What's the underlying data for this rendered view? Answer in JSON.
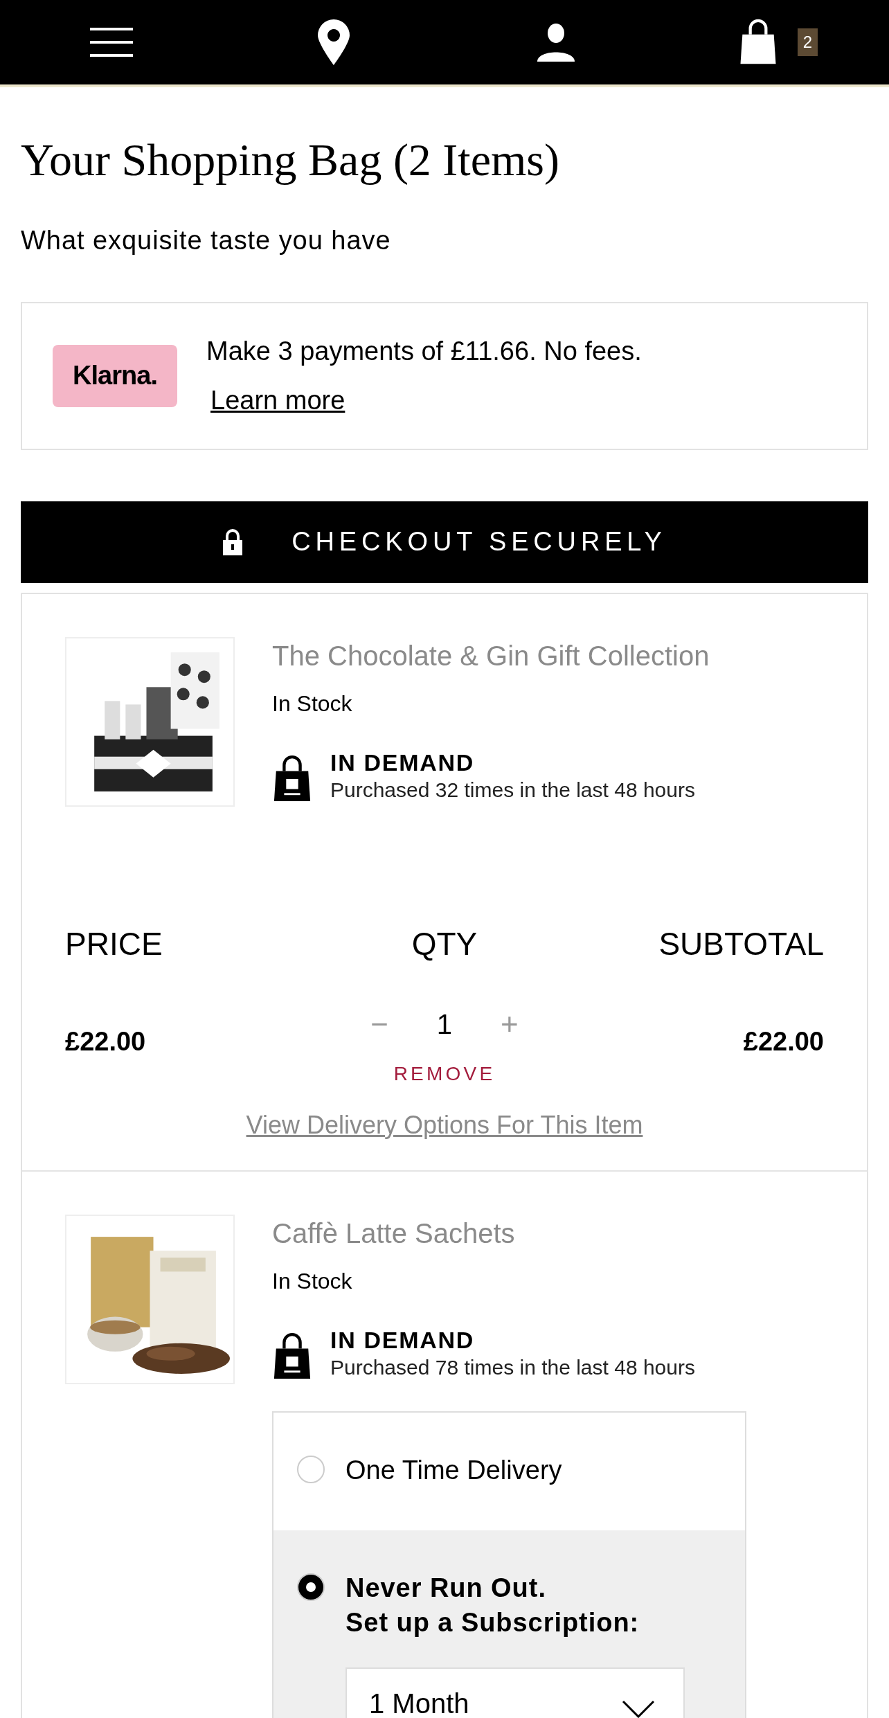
{
  "header": {
    "bag_count": "2"
  },
  "title": "Your Shopping Bag (2 Items)",
  "subtitle": "What exquisite taste you have",
  "klarna": {
    "logo": "Klarna.",
    "message": "Make 3 payments of £11.66. No fees.",
    "link": "Learn more"
  },
  "checkout_button": "CHECKOUT SECURELY",
  "items": [
    {
      "name": "The Chocolate & Gin Gift Collection",
      "stock": "In Stock",
      "demand_title": "IN DEMAND",
      "demand_text": "Purchased 32 times in the last 48 hours",
      "price_label": "PRICE",
      "qty_label": "QTY",
      "subtotal_label": "SUBTOTAL",
      "price": "£22.00",
      "minus": "−",
      "qty": "1",
      "plus": "+",
      "subtotal": "£22.00",
      "remove": "REMOVE",
      "delivery_link": "View Delivery Options For This Item"
    },
    {
      "name": "Caffè Latte Sachets",
      "stock": "In Stock",
      "demand_title": "IN DEMAND",
      "demand_text": "Purchased 78 times in the last 48 hours",
      "delivery_options": [
        {
          "label": "One Time Delivery",
          "selected": false
        },
        {
          "label": "Never Run Out.",
          "sublabel": "Set up a Subscription:",
          "selected": true,
          "frequency": "1 Month"
        }
      ]
    }
  ]
}
